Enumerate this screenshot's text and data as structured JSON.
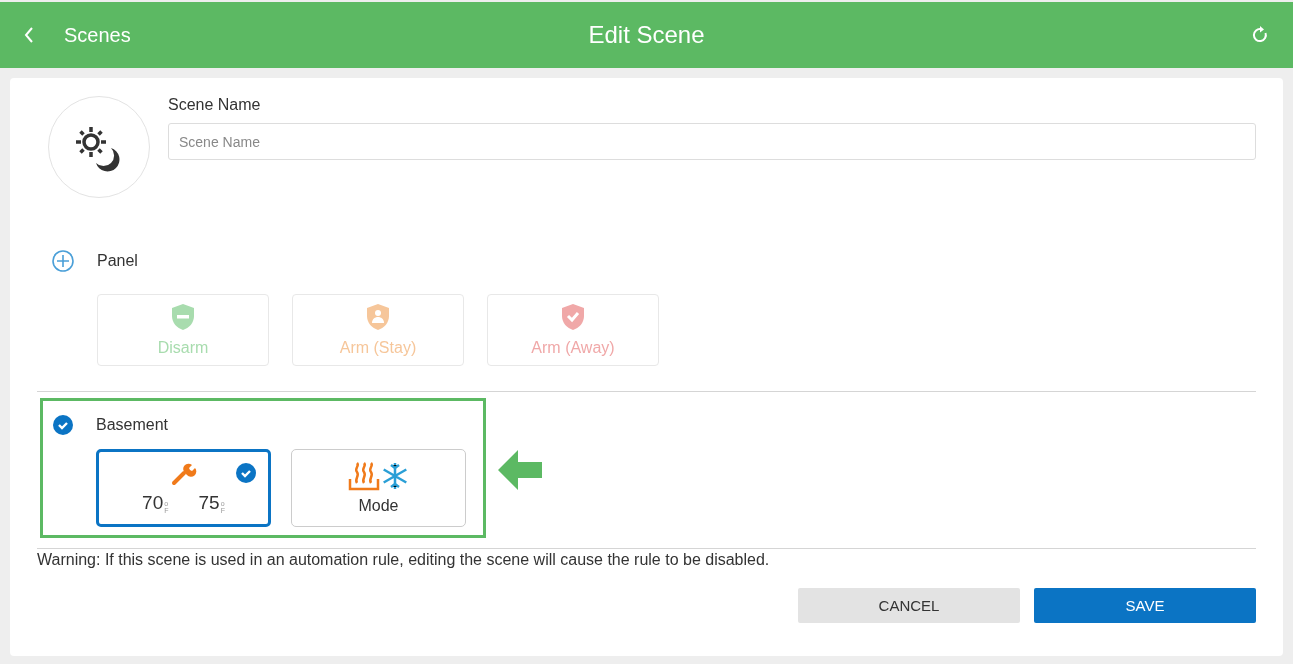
{
  "header": {
    "back_label": "Scenes",
    "title": "Edit Scene"
  },
  "scene_name": {
    "label": "Scene Name",
    "placeholder": "Scene Name"
  },
  "panel": {
    "label": "Panel",
    "expanded": false,
    "actions": [
      {
        "kind": "disarm",
        "label": "Disarm",
        "color": "#a8dcae",
        "disabled": true
      },
      {
        "kind": "stay",
        "label": "Arm (Stay)",
        "color": "#f6c69a",
        "disabled": true
      },
      {
        "kind": "away",
        "label": "Arm (Away)",
        "color": "#f0a8a8",
        "disabled": true
      }
    ]
  },
  "thermostat": {
    "label": "Basement",
    "checked": true,
    "highlighted": true,
    "tiles": [
      {
        "kind": "setpoints",
        "selected": true,
        "setpoints": [
          {
            "value": "70",
            "unit_top": "o",
            "unit_bottom": "F"
          },
          {
            "value": "75",
            "unit_top": "o",
            "unit_bottom": "F"
          }
        ]
      },
      {
        "kind": "mode",
        "selected": false,
        "label": "Mode"
      }
    ]
  },
  "warning": "Warning: If this scene is used in an automation rule, editing the scene will cause the rule to be disabled.",
  "buttons": [
    {
      "kind": "secondary",
      "label": "CANCEL"
    },
    {
      "kind": "primary",
      "label": "SAVE"
    }
  ]
}
